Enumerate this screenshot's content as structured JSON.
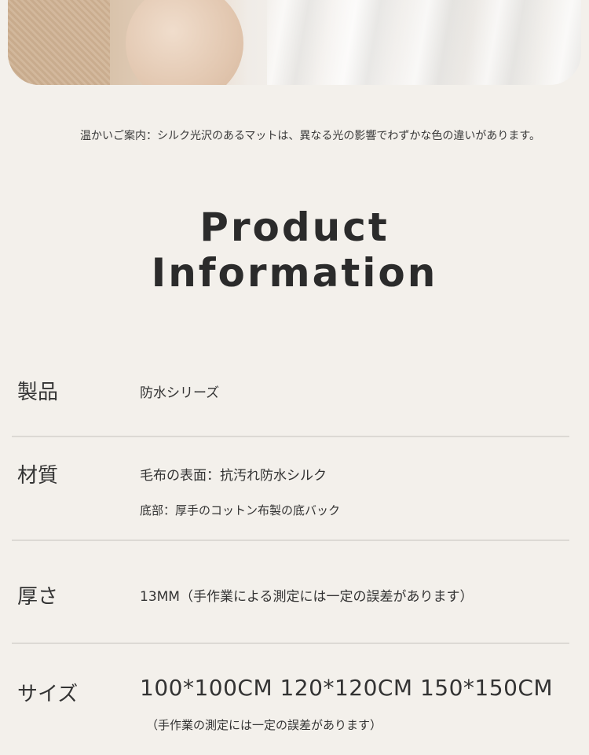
{
  "notice": "温かいご案内：シルク光沢のあるマットは、異なる光の影響でわずかな色の違いがあります。",
  "heading": {
    "line1": "Product",
    "line2": "Information"
  },
  "rows": [
    {
      "label": "製品",
      "values": [
        "防水シリーズ"
      ]
    },
    {
      "label": "材質",
      "values": [
        "毛布の表面：抗汚れ防水シルク",
        "底部：厚手のコットン布製の底バック"
      ]
    },
    {
      "label": "厚さ",
      "values": [
        "13MM（手作業による測定には一定の誤差があります）"
      ]
    },
    {
      "label": "サイズ",
      "values": [
        "100*100CM 120*120CM 150*150CM",
        "（手作業の測定には一定の誤差があります）"
      ]
    }
  ]
}
